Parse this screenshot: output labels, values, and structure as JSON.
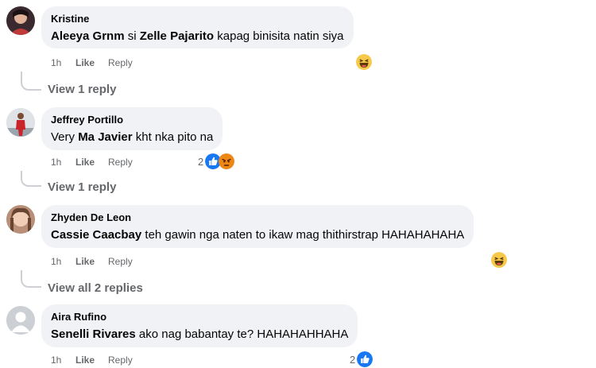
{
  "comments": [
    {
      "author": "Kristine",
      "mention1": "Aleeya Grnm",
      "text1": " si ",
      "mention2": "Zelle Pajarito",
      "text2": " kapag binisita natin siya",
      "time": "1h",
      "like": "Like",
      "reply": "Reply",
      "reaction_emoji": "haha-icon",
      "view_replies": "View 1 reply"
    },
    {
      "author": "Jeffrey Portillo",
      "pre": "Very ",
      "mention1": "Ma Javier",
      "text1": " kht nka pito na",
      "time": "1h",
      "like": "Like",
      "reply": "Reply",
      "reaction_count": "2",
      "reaction_emoji": [
        "thumbs-up-icon",
        "angry-icon"
      ],
      "view_replies": "View 1 reply"
    },
    {
      "author": "Zhyden De Leon",
      "mention1": "Cassie Caacbay",
      "text1": " teh gawin nga naten to ikaw mag thithirstrap HAHAHAHAHA",
      "time": "1h",
      "like": "Like",
      "reply": "Reply",
      "reaction_emoji": "haha-icon",
      "view_replies": "View all 2 replies"
    },
    {
      "author": "Aira Rufino",
      "mention1": "Senelli Rivares",
      "text1": " ako nag babantay te? HAHAHAHHAHA",
      "time": "1h",
      "like": "Like",
      "reply": "Reply",
      "reaction_count": "2",
      "reaction_emoji": "thumbs-up-icon"
    }
  ],
  "colors": {
    "bubble": "#f0f2f5",
    "meta": "#65676b",
    "like_blue": "#1877f2",
    "haha_yellow": "#f7c94a",
    "angry_red": "#e9710f"
  }
}
